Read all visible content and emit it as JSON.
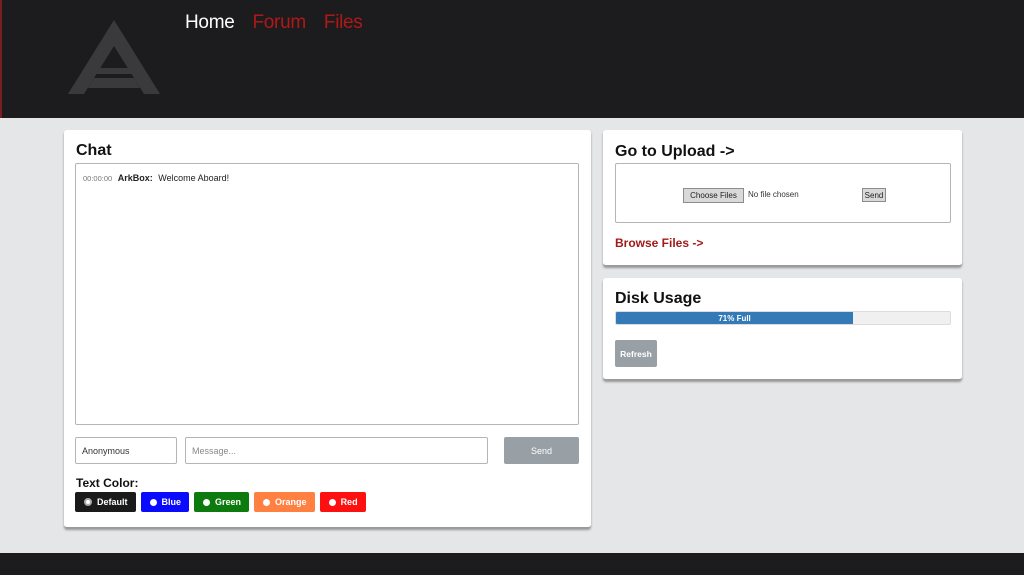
{
  "nav": {
    "home": "Home",
    "forum": "Forum",
    "files": "Files"
  },
  "chat": {
    "title": "Chat",
    "messages": [
      {
        "timestamp": "00:00:00",
        "user": "ArkBox:",
        "text": "Welcome Aboard!"
      }
    ],
    "name_value": "Anonymous",
    "message_placeholder": "Message...",
    "send_label": "Send",
    "text_color_label": "Text Color:",
    "colors": [
      {
        "label": "Default",
        "color": "#1a1a1a"
      },
      {
        "label": "Blue",
        "color": "#0a0aff"
      },
      {
        "label": "Green",
        "color": "#0c7a0c"
      },
      {
        "label": "Orange",
        "color": "#ff8040"
      },
      {
        "label": "Red",
        "color": "#ff1010"
      }
    ]
  },
  "upload": {
    "title": "Go to Upload ->",
    "choose_label": "Choose Files",
    "no_file_text": "No file chosen",
    "send_label": "Send",
    "browse_label": "Browse Files ->"
  },
  "disk": {
    "title": "Disk Usage",
    "usage_percent": 71,
    "usage_label": "71% Full",
    "refresh_label": "Refresh"
  },
  "colors": {
    "header_bg": "#1c1c1e",
    "accent_red": "#b01818",
    "progress_blue": "#337ab7"
  }
}
